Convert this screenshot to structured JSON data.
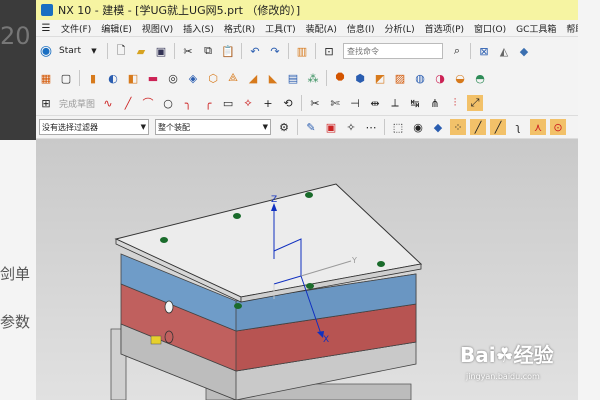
{
  "window": {
    "title": "NX 10 - 建模 - [学UG就上UG网5.prt （修改的）]"
  },
  "menubar": {
    "items": [
      "文件(F)",
      "编辑(E)",
      "视图(V)",
      "插入(S)",
      "格式(R)",
      "工具(T)",
      "装配(A)",
      "信息(I)",
      "分析(L)",
      "首选项(P)",
      "窗口(O)",
      "GC工具箱",
      "帮助(H)"
    ]
  },
  "toolbar": {
    "start_label": "Start",
    "search_placeholder": "查找命令",
    "sketch_finish_label": "完成草图"
  },
  "selection_bar": {
    "filter_value": "没有选择过滤器",
    "scope_value": "整个装配"
  },
  "viewport": {
    "axis_z": "Z",
    "axis_x": "X",
    "axis_y": "Y"
  },
  "background": {
    "left_text_1": "剑单",
    "left_text_2": "参数",
    "left_number": "20"
  },
  "watermark": {
    "brand": "Bai",
    "brand2": "经验",
    "url": "jingyan.baidu.com"
  },
  "colors": {
    "title_bg": "#f6f4a2",
    "plate_top": "#ececec",
    "plate_blue": "#6f9cc8",
    "plate_red": "#c0605e",
    "plate_gray": "#b9b9b9",
    "dot_green": "#1a6b2b"
  }
}
